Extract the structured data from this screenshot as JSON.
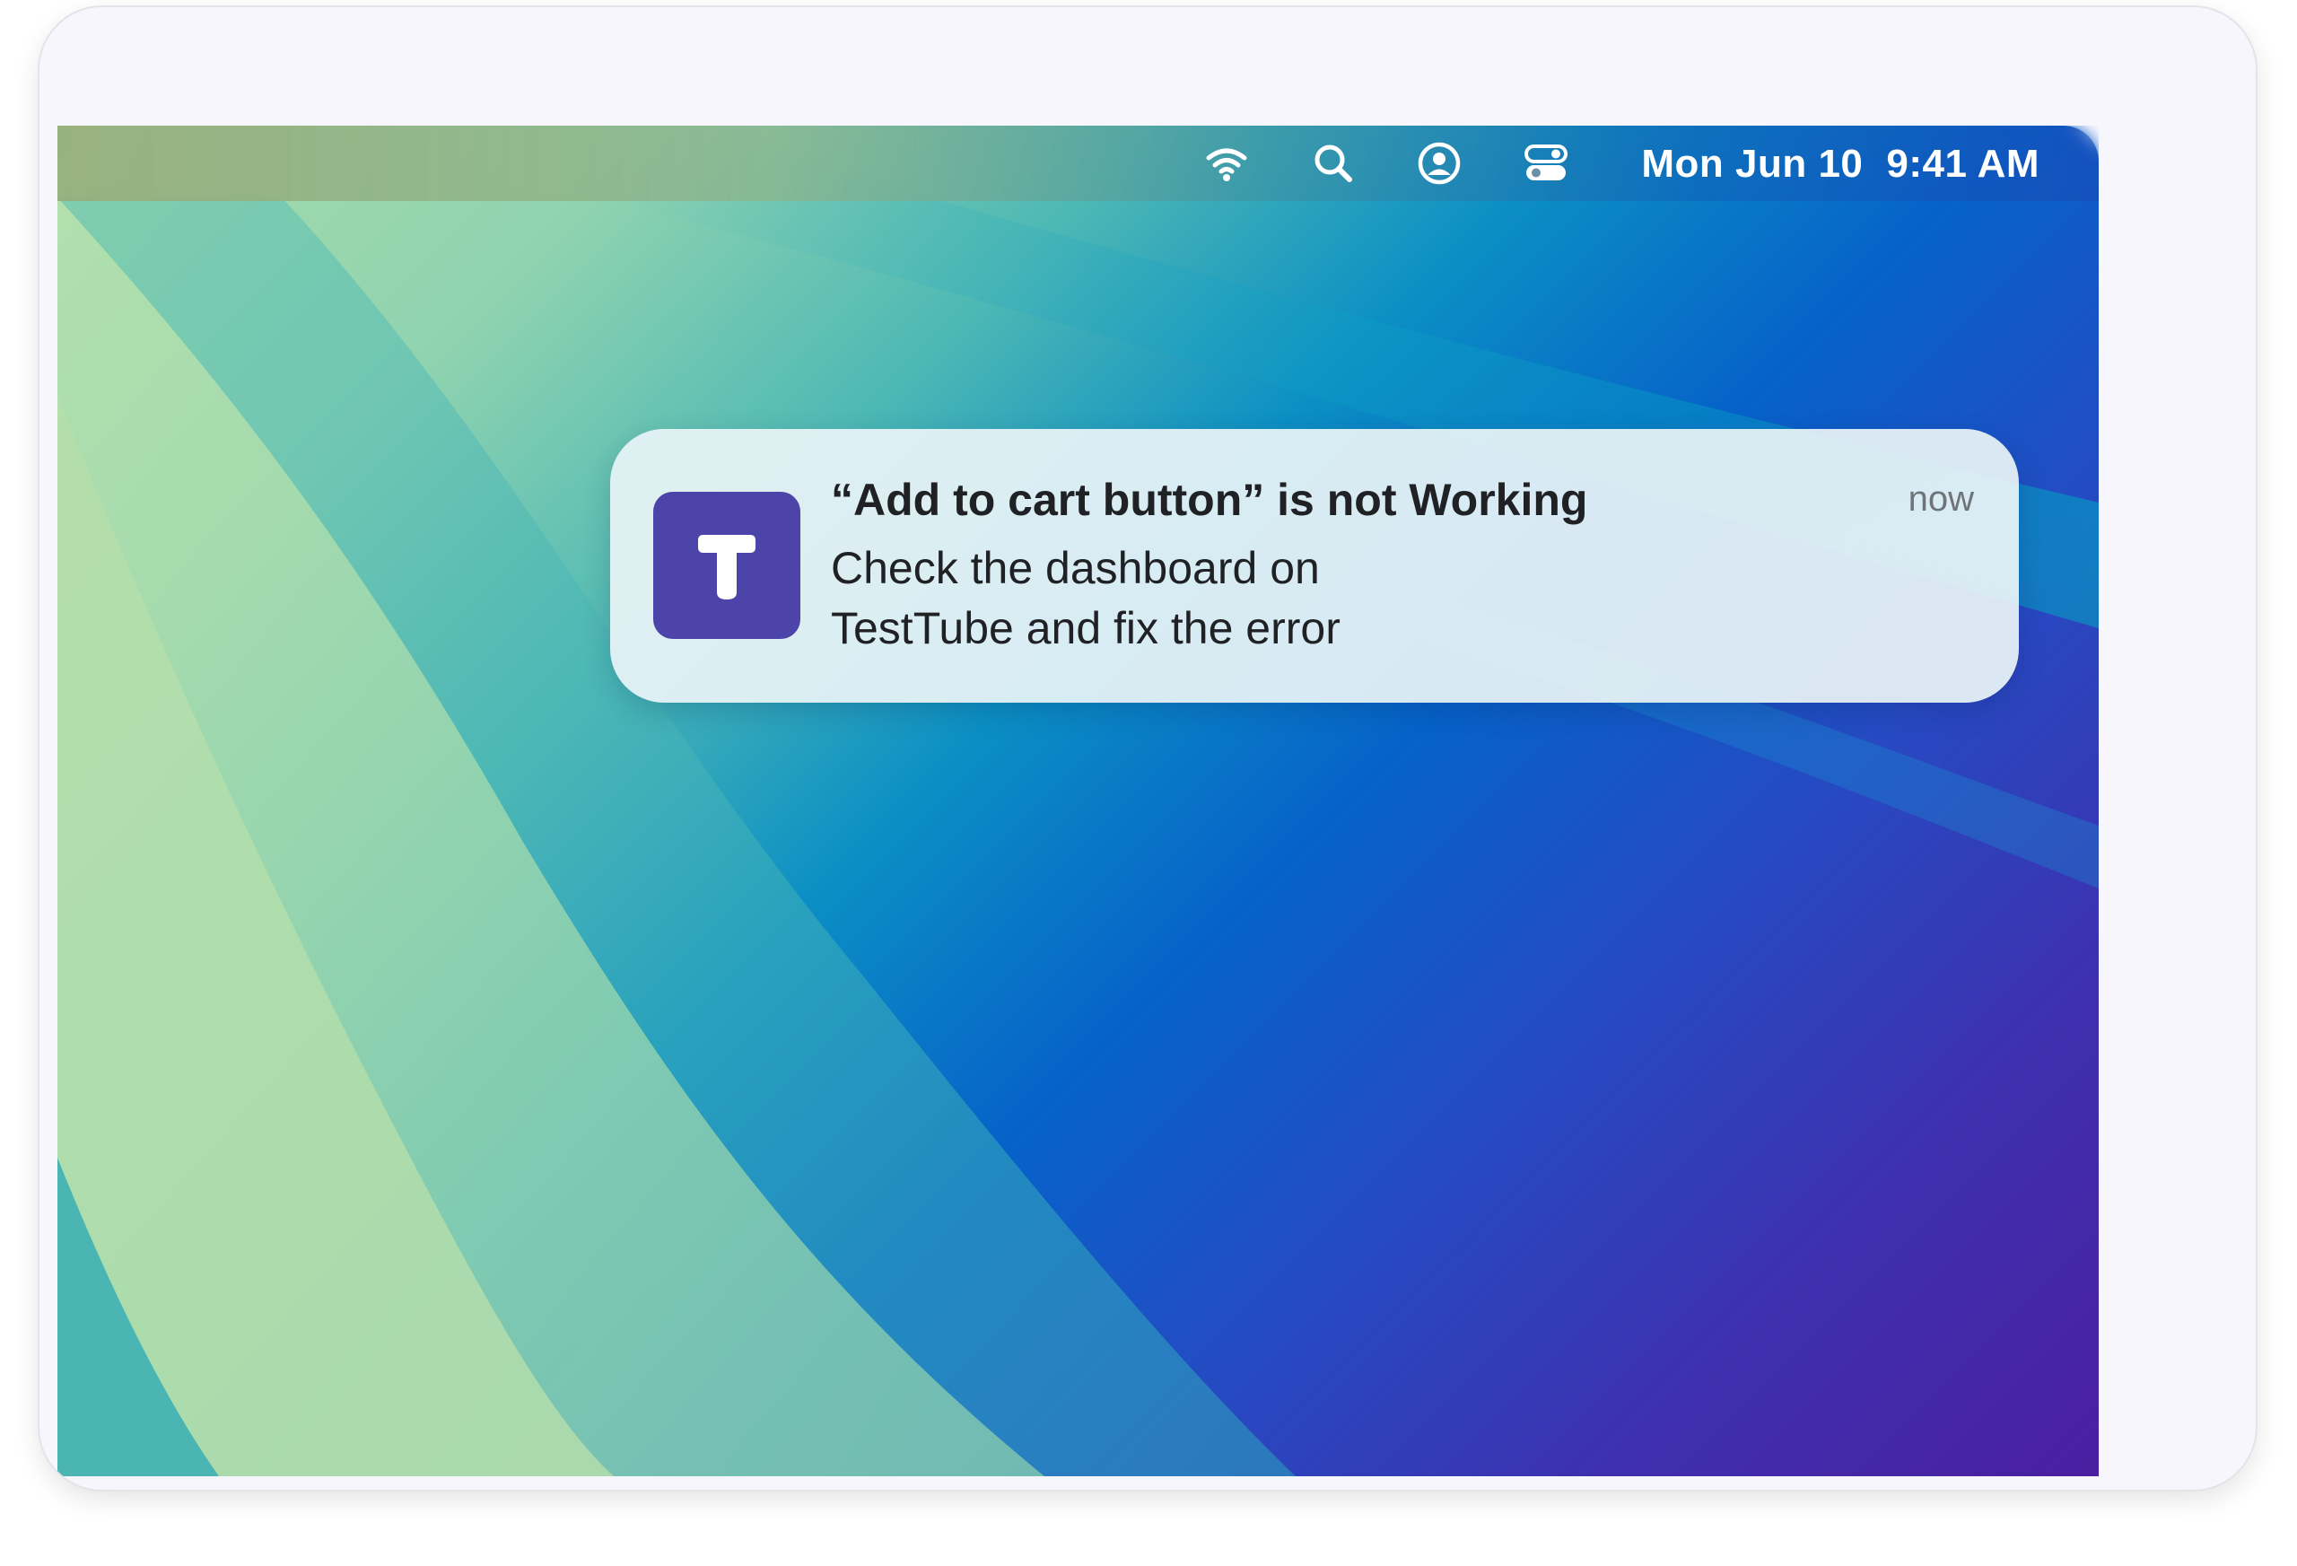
{
  "menubar": {
    "icons": [
      "wifi-icon",
      "search-icon",
      "user-account-icon",
      "control-center-icon"
    ],
    "date": "Mon Jun 10",
    "time": "9:41 AM"
  },
  "notification": {
    "app_icon_letter": "T",
    "app_icon_color": "#4c44a8",
    "title": "“Add to cart button” is not Working",
    "body_line1": "Check the dashboard on",
    "body_line2": "TestTube and fix the error",
    "time": "now"
  }
}
